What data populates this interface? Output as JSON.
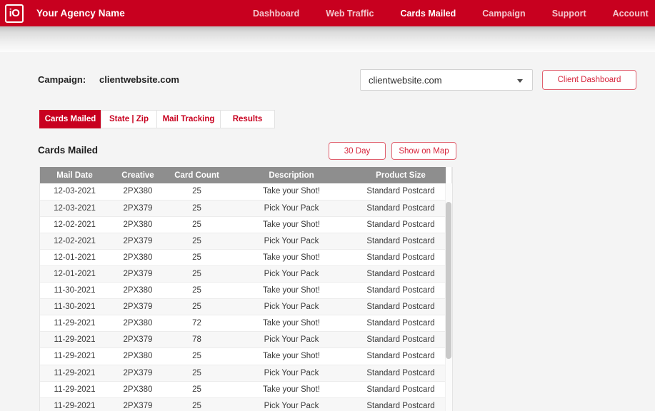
{
  "nav": {
    "logo_text": "iO",
    "agency_name": "Your Agency Name",
    "items": [
      {
        "label": "Dashboard",
        "active": false
      },
      {
        "label": "Web Traffic",
        "active": false
      },
      {
        "label": "Cards Mailed",
        "active": true
      },
      {
        "label": "Campaign",
        "active": false
      },
      {
        "label": "Support",
        "active": false
      },
      {
        "label": "Account",
        "active": false
      }
    ],
    "brand_color": "#c8001f"
  },
  "campaign": {
    "label": "Campaign:",
    "value": "clientwebsite.com",
    "select_value": "clientwebsite.com",
    "client_dashboard_button": "Client Dashboard"
  },
  "tabs": [
    {
      "label": "Cards Mailed",
      "active": true
    },
    {
      "label": "State | Zip",
      "active": false
    },
    {
      "label": "Mail Tracking",
      "active": false
    },
    {
      "label": "Results",
      "active": false
    }
  ],
  "section": {
    "title": "Cards Mailed",
    "range_button": "30 Day",
    "map_button": "Show on Map"
  },
  "table": {
    "columns": [
      "Mail Date",
      "Creative",
      "Card Count",
      "Description",
      "Product Size"
    ],
    "rows": [
      [
        "12-03-2021",
        "2PX380",
        "25",
        "Take your Shot!",
        "Standard Postcard"
      ],
      [
        "12-03-2021",
        "2PX379",
        "25",
        "Pick Your Pack",
        "Standard Postcard"
      ],
      [
        "12-02-2021",
        "2PX380",
        "25",
        "Take your Shot!",
        "Standard Postcard"
      ],
      [
        "12-02-2021",
        "2PX379",
        "25",
        "Pick Your Pack",
        "Standard Postcard"
      ],
      [
        "12-01-2021",
        "2PX380",
        "25",
        "Take your Shot!",
        "Standard Postcard"
      ],
      [
        "12-01-2021",
        "2PX379",
        "25",
        "Pick Your Pack",
        "Standard Postcard"
      ],
      [
        "11-30-2021",
        "2PX380",
        "25",
        "Take your Shot!",
        "Standard Postcard"
      ],
      [
        "11-30-2021",
        "2PX379",
        "25",
        "Pick Your Pack",
        "Standard Postcard"
      ],
      [
        "11-29-2021",
        "2PX380",
        "72",
        "Take your Shot!",
        "Standard Postcard"
      ],
      [
        "11-29-2021",
        "2PX379",
        "78",
        "Pick Your Pack",
        "Standard Postcard"
      ],
      [
        "11-29-2021",
        "2PX380",
        "25",
        "Take your Shot!",
        "Standard Postcard"
      ],
      [
        "11-29-2021",
        "2PX379",
        "25",
        "Pick Your Pack",
        "Standard Postcard"
      ],
      [
        "11-29-2021",
        "2PX380",
        "25",
        "Take your Shot!",
        "Standard Postcard"
      ],
      [
        "11-29-2021",
        "2PX379",
        "25",
        "Pick Your Pack",
        "Standard Postcard"
      ]
    ]
  },
  "colors": {
    "brand_red": "#c8001f",
    "button_red": "#d7253c",
    "header_gray": "#8e8e8e",
    "page_bg": "#f4f4f4"
  }
}
